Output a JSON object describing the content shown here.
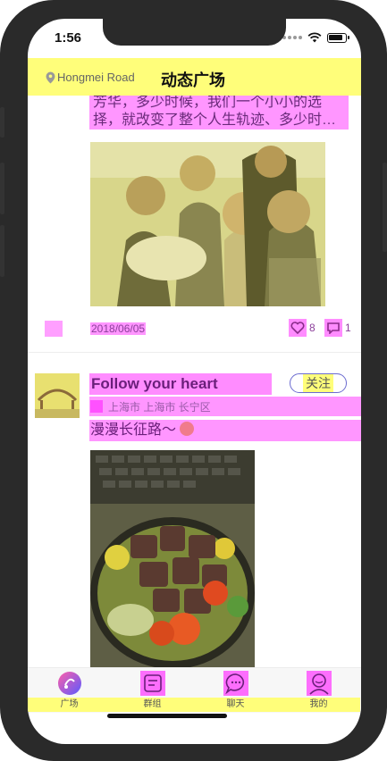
{
  "status": {
    "time": "1:56"
  },
  "header": {
    "location": "Hongmei Road",
    "title": "动态广场"
  },
  "post1": {
    "text": "芳华，多少时候，我们一个小小的选择，就改变了整个人生轨迹、多少时…",
    "date": "2018/06/05",
    "likes": "8",
    "comments": "1"
  },
  "post2": {
    "username": "Follow your heart",
    "follow_label": "关注",
    "address": "上海市 上海市 长宁区",
    "text": "漫漫长征路～"
  },
  "tabs": [
    {
      "label": "广场",
      "icon": "plaza-icon"
    },
    {
      "label": "群组",
      "icon": "group-icon"
    },
    {
      "label": "聊天",
      "icon": "chat-icon"
    },
    {
      "label": "我的",
      "icon": "profile-icon"
    }
  ],
  "colors": {
    "header_bg": "#fffe7a",
    "highlight": "#ff40ff",
    "accent": "#7a5cff"
  }
}
